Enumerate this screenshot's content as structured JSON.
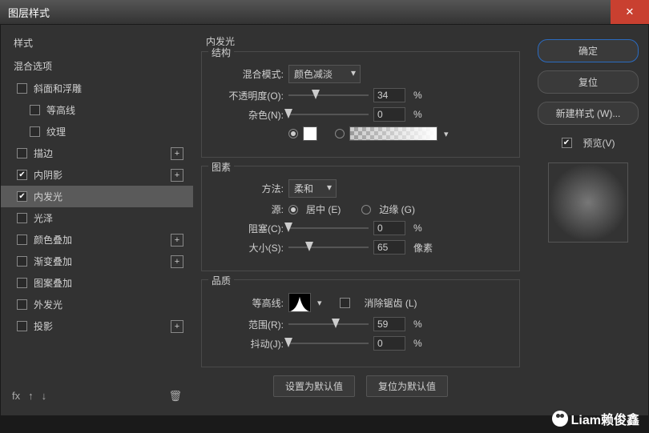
{
  "window": {
    "title": "图层样式"
  },
  "sidebar": {
    "head": "样式",
    "sub": "混合选项",
    "items": [
      {
        "label": "斜面和浮雕",
        "checked": false,
        "plus": false,
        "indent": false
      },
      {
        "label": "等高线",
        "checked": false,
        "plus": false,
        "indent": true
      },
      {
        "label": "纹理",
        "checked": false,
        "plus": false,
        "indent": true
      },
      {
        "label": "描边",
        "checked": false,
        "plus": true,
        "indent": false
      },
      {
        "label": "内阴影",
        "checked": true,
        "plus": true,
        "indent": false
      },
      {
        "label": "内发光",
        "checked": true,
        "plus": false,
        "indent": false,
        "selected": true
      },
      {
        "label": "光泽",
        "checked": false,
        "plus": false,
        "indent": false
      },
      {
        "label": "颜色叠加",
        "checked": false,
        "plus": true,
        "indent": false
      },
      {
        "label": "渐变叠加",
        "checked": false,
        "plus": true,
        "indent": false
      },
      {
        "label": "图案叠加",
        "checked": false,
        "plus": false,
        "indent": false
      },
      {
        "label": "外发光",
        "checked": false,
        "plus": false,
        "indent": false
      },
      {
        "label": "投影",
        "checked": false,
        "plus": true,
        "indent": false
      }
    ],
    "fx": "fx"
  },
  "main": {
    "title": "内发光",
    "structure": {
      "legend": "结构",
      "blendmode_label": "混合模式:",
      "blendmode_value": "颜色减淡",
      "opacity_label": "不透明度(O):",
      "opacity_value": "34",
      "opacity_unit": "%",
      "noise_label": "杂色(N):",
      "noise_value": "0",
      "noise_unit": "%"
    },
    "elements": {
      "legend": "图素",
      "technique_label": "方法:",
      "technique_value": "柔和",
      "source_label": "源:",
      "source_center": "居中 (E)",
      "source_edge": "边缘 (G)",
      "choke_label": "阻塞(C):",
      "choke_value": "0",
      "choke_unit": "%",
      "size_label": "大小(S):",
      "size_value": "65",
      "size_unit": "像素"
    },
    "quality": {
      "legend": "品质",
      "contour_label": "等高线:",
      "antialias_label": "消除锯齿 (L)",
      "range_label": "范围(R):",
      "range_value": "59",
      "range_unit": "%",
      "jitter_label": "抖动(J):",
      "jitter_value": "0",
      "jitter_unit": "%"
    },
    "buttons": {
      "default": "设置为默认值",
      "reset": "复位为默认值"
    }
  },
  "right": {
    "ok": "确定",
    "cancel": "复位",
    "newstyle": "新建样式 (W)...",
    "preview": "预览(V)"
  },
  "watermark": "Liam赖俊鑫"
}
